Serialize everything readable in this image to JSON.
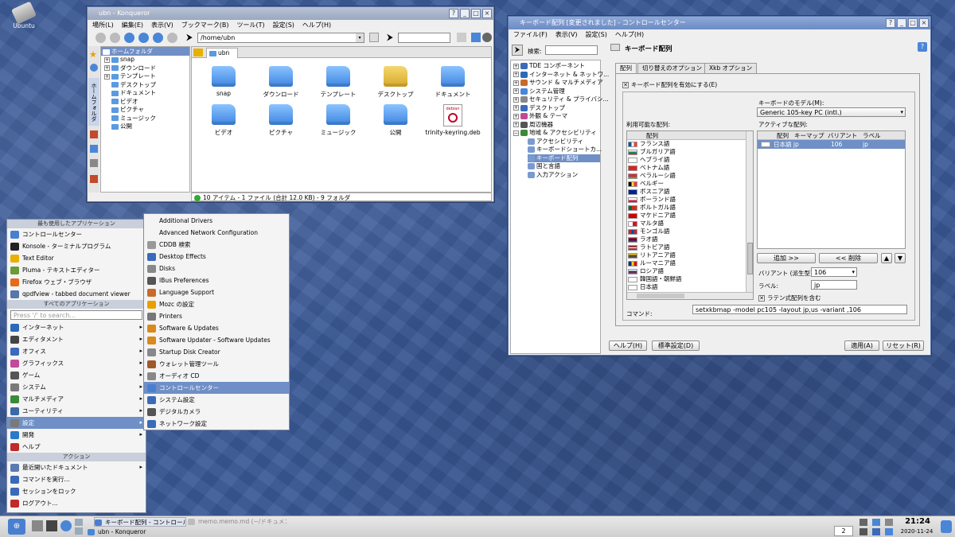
{
  "desktop": {
    "icon_label": "Ubuntu"
  },
  "konqueror": {
    "title": "ubn - Konqueror",
    "menu": [
      "場所(L)",
      "編集(E)",
      "表示(V)",
      "ブックマーク(B)",
      "ツール(T)",
      "設定(S)",
      "ヘルプ(H)"
    ],
    "location": "/home/ubn",
    "sidebar_title": "ホームフォルダ",
    "sidebar_tab": "ホームフォルダ",
    "tree": [
      "snap",
      "ダウンロード",
      "テンプレート",
      "デスクトップ",
      "ドキュメント",
      "ビデオ",
      "ピクチャ",
      "ミュージック",
      "公開"
    ],
    "tab_label": "ubn",
    "files": [
      "snap",
      "ダウンロード",
      "テンプレート",
      "デスクトップ",
      "ドキュメント",
      "ビデオ",
      "ピクチャ",
      "ミュージック",
      "公開",
      "trinity-keyring.deb"
    ],
    "deb_icon_text": "debian",
    "status": "10 アイテム - 1 ファイル (合計 12.0 KB) - 9 フォルダ"
  },
  "control": {
    "title": "キーボード配列 [変更されました] - コントロールセンター",
    "menu": [
      "ファイル(F)",
      "表示(V)",
      "設定(S)",
      "ヘルプ(H)"
    ],
    "search_label": "検索:",
    "tree": [
      {
        "label": "TDE コンポーネント",
        "exp": "+"
      },
      {
        "label": "インターネット & ネットワ...",
        "exp": "+"
      },
      {
        "label": "サウンド & マルチメディア",
        "exp": "+"
      },
      {
        "label": "システム管理",
        "exp": "+"
      },
      {
        "label": "セキュリティ & プライバシ...",
        "exp": "+"
      },
      {
        "label": "デスクトップ",
        "exp": "+"
      },
      {
        "label": "外観 & テーマ",
        "exp": "+"
      },
      {
        "label": "周辺機器",
        "exp": "+"
      },
      {
        "label": "地域 & アクセシビリティ",
        "exp": "−"
      }
    ],
    "subtree": [
      "アクセシビリティ",
      "キーボードショートカ...",
      "キーボード配列",
      "国と言語",
      "入力アクション"
    ],
    "page_title": "キーボード配列",
    "tabs": [
      "配列",
      "切り替えのオプション",
      "Xkb オプション"
    ],
    "enable_label": "キーボード配列を有効にする(E)",
    "model_label": "キーボードのモデル(M):",
    "model_value": "Generic 105-key PC (intl.)",
    "available_label": "利用可能な配列:",
    "available_header": "配列",
    "available": [
      "フランス語",
      "ブルガリア語",
      "ヘブライ語",
      "ベトナム語",
      "ベラルーシ語",
      "ベルギー",
      "ボスニア語",
      "ポーランド語",
      "ポルトガル語",
      "マケドニア語",
      "マルタ語",
      "モンゴル語",
      "ラオ語",
      "ラトビア語",
      "リトアニア語",
      "ルーマニア語",
      "ロシア語",
      "韓国語・朝鮮語",
      "日本語"
    ],
    "active_label": "アクティブな配列:",
    "active_headers": [
      "配列",
      "キーマップ",
      "バリアント",
      "ラベル"
    ],
    "active_row": [
      "日本語 jp",
      "",
      "106",
      "jp"
    ],
    "add_label": "追加 >>",
    "remove_label": "<< 削除",
    "variant_label": "バリアント (派生型):",
    "variant_value": "106",
    "label_label": "ラベル:",
    "label_value": "jp",
    "latin_label": "ラテン式配列を含む",
    "command_label": "コマンド:",
    "command_value": "setxkbmap -model pc105 -layout jp,us -variant ,106",
    "help_btn": "ヘルプ(H)",
    "defaults_btn": "標準設定(D)",
    "apply_btn": "適用(A)",
    "reset_btn": "リセット(R)"
  },
  "start_menu": {
    "most_used": "最も使用したアプリケーション",
    "recent": [
      {
        "label": "コントロールセンター",
        "color": "#4a7fd0"
      },
      {
        "label": "Konsole - ターミナルプログラム",
        "color": "#222"
      },
      {
        "label": "Text Editor",
        "color": "#e8b000"
      },
      {
        "label": "Pluma - テキストエディター",
        "color": "#6a9a3a"
      },
      {
        "label": "Firefox ウェブ・ブラウザ",
        "color": "#e66a1a"
      },
      {
        "label": "qpdfview - tabbed document viewer",
        "color": "#5577aa"
      }
    ],
    "all_apps": "すべてのアプリケーション",
    "search_placeholder": "Press '/' to search...",
    "categories": [
      {
        "label": "インターネット",
        "color": "#2a6ab8"
      },
      {
        "label": "エディタメント",
        "color": "#444"
      },
      {
        "label": "オフィス",
        "color": "#3a6ac0"
      },
      {
        "label": "グラフィックス",
        "color": "#c04a9a"
      },
      {
        "label": "ゲーム",
        "color": "#555"
      },
      {
        "label": "システム",
        "color": "#7a7a7a"
      },
      {
        "label": "マルチメディア",
        "color": "#3a8a3a"
      },
      {
        "label": "ユーティリティ",
        "color": "#3a6aa8"
      },
      {
        "label": "設定",
        "color": "#7a7a7a"
      },
      {
        "label": "開発",
        "color": "#2a7ac8"
      },
      {
        "label": "ヘルプ",
        "color": "#c02a2a"
      }
    ],
    "actions": "アクション",
    "action_items": [
      {
        "label": "最近開いたドキュメント",
        "color": "#5a7ab0"
      },
      {
        "label": "コマンドを実行...",
        "color": "#3a6ab8"
      },
      {
        "label": "セッションをロック",
        "color": "#3a6ab8"
      },
      {
        "label": "ログアウト...",
        "color": "#c02a2a"
      }
    ]
  },
  "submenu": [
    {
      "label": "Additional Drivers",
      "color": ""
    },
    {
      "label": "Advanced Network Configuration",
      "color": ""
    },
    {
      "label": "CDDB 検索",
      "color": "#999"
    },
    {
      "label": "Desktop Effects",
      "color": "#3a6ab8"
    },
    {
      "label": "Disks",
      "color": "#888"
    },
    {
      "label": "IBus Preferences",
      "color": "#555"
    },
    {
      "label": "Language Support",
      "color": "#c86a2a"
    },
    {
      "label": "Mozc の設定",
      "color": "#e8a000"
    },
    {
      "label": "Printers",
      "color": "#777"
    },
    {
      "label": "Software & Updates",
      "color": "#d88a1a"
    },
    {
      "label": "Software Updater - Software Updates",
      "color": "#d88a1a"
    },
    {
      "label": "Startup Disk Creator",
      "color": "#888"
    },
    {
      "label": "ウォレット管理ツール",
      "color": "#a05a2a"
    },
    {
      "label": "オーディオ CD",
      "color": "#888"
    },
    {
      "label": "コントロールセンター",
      "color": "#4a7fd0"
    },
    {
      "label": "システム設定",
      "color": "#3a6ab8"
    },
    {
      "label": "デジタルカメラ",
      "color": "#555"
    },
    {
      "label": "ネットワーク設定",
      "color": "#3a6ab8"
    }
  ],
  "taskbar": {
    "tasks": [
      "キーボード配列 - コントロール",
      "memo.memo.md (~/ドキュメント",
      "ubn - Konqueror"
    ],
    "desk_num": "2",
    "time": "21:24",
    "date": "2020-11-24"
  }
}
